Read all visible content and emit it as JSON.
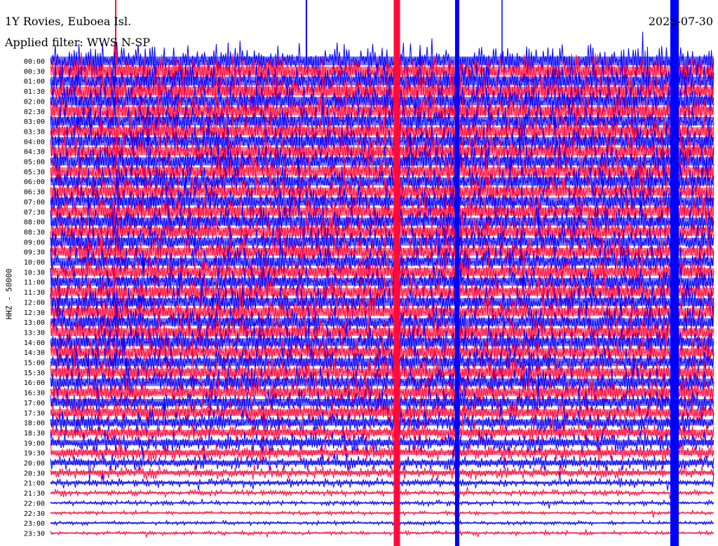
{
  "station_title": "1Y Rovies, Euboea Isl.",
  "date": "2025-07-30",
  "filter_label": "Applied filter: WWS N-SP",
  "y_axis_label": "HHZ - 50000",
  "colors": {
    "trace_a": "#0000ff",
    "trace_b": "#ff0a3a",
    "background": "#ffffff"
  },
  "chart_data": {
    "type": "line",
    "description_note": "",
    "tick_labels": [
      "00:00",
      "00:30",
      "01:00",
      "01:30",
      "02:00",
      "02:30",
      "03:00",
      "03:30",
      "04:00",
      "04:30",
      "05:00",
      "05:30",
      "06:00",
      "06:30",
      "07:00",
      "07:30",
      "08:00",
      "08:30",
      "09:00",
      "09:30",
      "10:00",
      "10:30",
      "11:00",
      "11:30",
      "12:00",
      "12:30",
      "13:00",
      "13:30",
      "14:00",
      "14:30",
      "15:00",
      "15:30",
      "16:00",
      "16:30",
      "17:00",
      "17:30",
      "18:00",
      "18:30",
      "19:00",
      "19:30",
      "20:00",
      "20:30",
      "21:00",
      "21:30",
      "22:00",
      "22:30",
      "23:00",
      "23:30"
    ],
    "series": [
      {
        "color": "#0000ff"
      },
      {
        "color": "#ff0a3a"
      }
    ],
    "line_amplitudes": [
      1.6,
      1.6,
      1.6,
      1.6,
      1.55,
      1.55,
      1.55,
      1.5,
      1.5,
      1.5,
      1.5,
      1.5,
      1.45,
      1.45,
      1.45,
      1.45,
      1.45,
      1.45,
      1.4,
      1.4,
      1.4,
      1.4,
      1.4,
      1.4,
      1.4,
      1.4,
      1.4,
      1.4,
      1.4,
      1.35,
      1.35,
      1.35,
      1.35,
      1.3,
      1.25,
      1.2,
      1.1,
      1.0,
      0.95,
      0.85,
      0.75,
      0.6,
      0.45,
      0.3,
      0.25,
      0.2,
      0.2,
      0.2
    ],
    "x_range_minutes": [
      0,
      30
    ],
    "grid": false
  }
}
